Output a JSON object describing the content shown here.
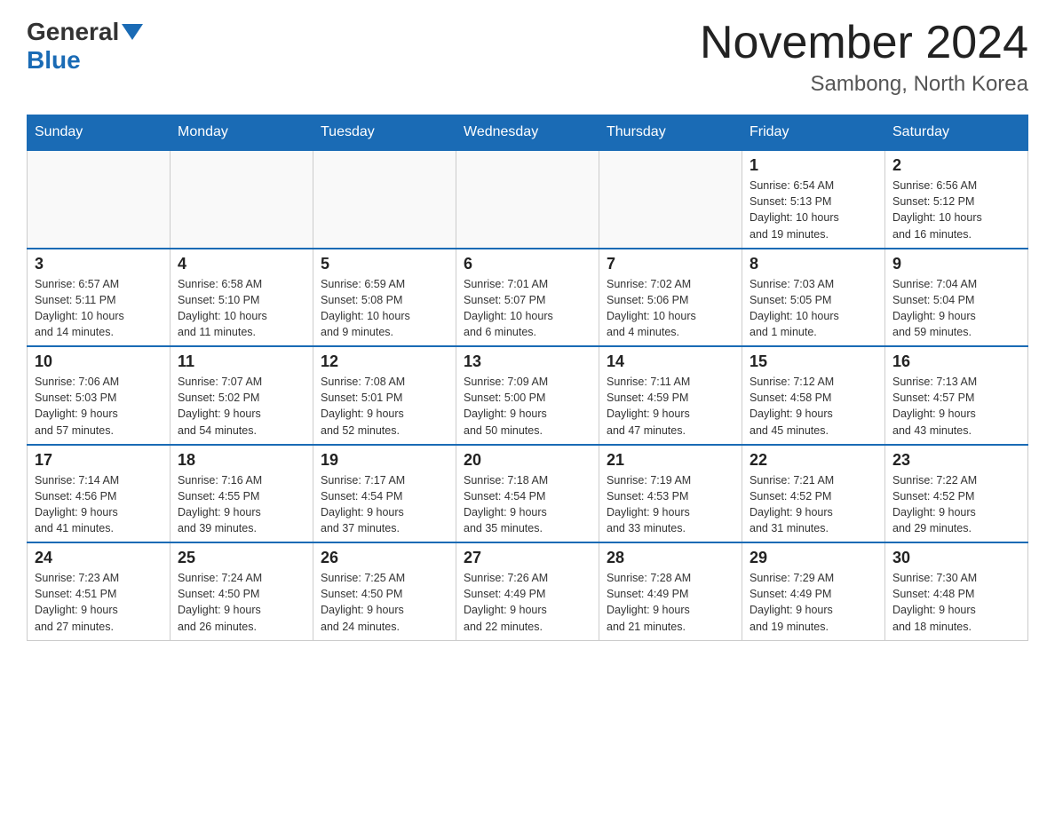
{
  "logo": {
    "general": "General",
    "blue": "Blue"
  },
  "title": "November 2024",
  "subtitle": "Sambong, North Korea",
  "days_of_week": [
    "Sunday",
    "Monday",
    "Tuesday",
    "Wednesday",
    "Thursday",
    "Friday",
    "Saturday"
  ],
  "weeks": [
    [
      {
        "day": "",
        "info": ""
      },
      {
        "day": "",
        "info": ""
      },
      {
        "day": "",
        "info": ""
      },
      {
        "day": "",
        "info": ""
      },
      {
        "day": "",
        "info": ""
      },
      {
        "day": "1",
        "info": "Sunrise: 6:54 AM\nSunset: 5:13 PM\nDaylight: 10 hours\nand 19 minutes."
      },
      {
        "day": "2",
        "info": "Sunrise: 6:56 AM\nSunset: 5:12 PM\nDaylight: 10 hours\nand 16 minutes."
      }
    ],
    [
      {
        "day": "3",
        "info": "Sunrise: 6:57 AM\nSunset: 5:11 PM\nDaylight: 10 hours\nand 14 minutes."
      },
      {
        "day": "4",
        "info": "Sunrise: 6:58 AM\nSunset: 5:10 PM\nDaylight: 10 hours\nand 11 minutes."
      },
      {
        "day": "5",
        "info": "Sunrise: 6:59 AM\nSunset: 5:08 PM\nDaylight: 10 hours\nand 9 minutes."
      },
      {
        "day": "6",
        "info": "Sunrise: 7:01 AM\nSunset: 5:07 PM\nDaylight: 10 hours\nand 6 minutes."
      },
      {
        "day": "7",
        "info": "Sunrise: 7:02 AM\nSunset: 5:06 PM\nDaylight: 10 hours\nand 4 minutes."
      },
      {
        "day": "8",
        "info": "Sunrise: 7:03 AM\nSunset: 5:05 PM\nDaylight: 10 hours\nand 1 minute."
      },
      {
        "day": "9",
        "info": "Sunrise: 7:04 AM\nSunset: 5:04 PM\nDaylight: 9 hours\nand 59 minutes."
      }
    ],
    [
      {
        "day": "10",
        "info": "Sunrise: 7:06 AM\nSunset: 5:03 PM\nDaylight: 9 hours\nand 57 minutes."
      },
      {
        "day": "11",
        "info": "Sunrise: 7:07 AM\nSunset: 5:02 PM\nDaylight: 9 hours\nand 54 minutes."
      },
      {
        "day": "12",
        "info": "Sunrise: 7:08 AM\nSunset: 5:01 PM\nDaylight: 9 hours\nand 52 minutes."
      },
      {
        "day": "13",
        "info": "Sunrise: 7:09 AM\nSunset: 5:00 PM\nDaylight: 9 hours\nand 50 minutes."
      },
      {
        "day": "14",
        "info": "Sunrise: 7:11 AM\nSunset: 4:59 PM\nDaylight: 9 hours\nand 47 minutes."
      },
      {
        "day": "15",
        "info": "Sunrise: 7:12 AM\nSunset: 4:58 PM\nDaylight: 9 hours\nand 45 minutes."
      },
      {
        "day": "16",
        "info": "Sunrise: 7:13 AM\nSunset: 4:57 PM\nDaylight: 9 hours\nand 43 minutes."
      }
    ],
    [
      {
        "day": "17",
        "info": "Sunrise: 7:14 AM\nSunset: 4:56 PM\nDaylight: 9 hours\nand 41 minutes."
      },
      {
        "day": "18",
        "info": "Sunrise: 7:16 AM\nSunset: 4:55 PM\nDaylight: 9 hours\nand 39 minutes."
      },
      {
        "day": "19",
        "info": "Sunrise: 7:17 AM\nSunset: 4:54 PM\nDaylight: 9 hours\nand 37 minutes."
      },
      {
        "day": "20",
        "info": "Sunrise: 7:18 AM\nSunset: 4:54 PM\nDaylight: 9 hours\nand 35 minutes."
      },
      {
        "day": "21",
        "info": "Sunrise: 7:19 AM\nSunset: 4:53 PM\nDaylight: 9 hours\nand 33 minutes."
      },
      {
        "day": "22",
        "info": "Sunrise: 7:21 AM\nSunset: 4:52 PM\nDaylight: 9 hours\nand 31 minutes."
      },
      {
        "day": "23",
        "info": "Sunrise: 7:22 AM\nSunset: 4:52 PM\nDaylight: 9 hours\nand 29 minutes."
      }
    ],
    [
      {
        "day": "24",
        "info": "Sunrise: 7:23 AM\nSunset: 4:51 PM\nDaylight: 9 hours\nand 27 minutes."
      },
      {
        "day": "25",
        "info": "Sunrise: 7:24 AM\nSunset: 4:50 PM\nDaylight: 9 hours\nand 26 minutes."
      },
      {
        "day": "26",
        "info": "Sunrise: 7:25 AM\nSunset: 4:50 PM\nDaylight: 9 hours\nand 24 minutes."
      },
      {
        "day": "27",
        "info": "Sunrise: 7:26 AM\nSunset: 4:49 PM\nDaylight: 9 hours\nand 22 minutes."
      },
      {
        "day": "28",
        "info": "Sunrise: 7:28 AM\nSunset: 4:49 PM\nDaylight: 9 hours\nand 21 minutes."
      },
      {
        "day": "29",
        "info": "Sunrise: 7:29 AM\nSunset: 4:49 PM\nDaylight: 9 hours\nand 19 minutes."
      },
      {
        "day": "30",
        "info": "Sunrise: 7:30 AM\nSunset: 4:48 PM\nDaylight: 9 hours\nand 18 minutes."
      }
    ]
  ]
}
